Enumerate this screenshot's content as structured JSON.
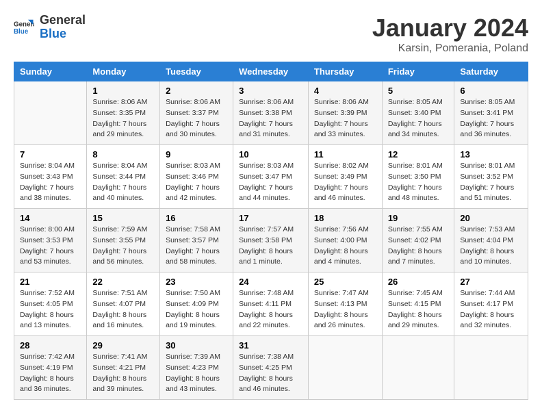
{
  "logo": {
    "line1": "General",
    "line2": "Blue"
  },
  "title": "January 2024",
  "subtitle": "Karsin, Pomerania, Poland",
  "days_of_week": [
    "Sunday",
    "Monday",
    "Tuesday",
    "Wednesday",
    "Thursday",
    "Friday",
    "Saturday"
  ],
  "weeks": [
    [
      {
        "day": "",
        "info": ""
      },
      {
        "day": "1",
        "info": "Sunrise: 8:06 AM\nSunset: 3:35 PM\nDaylight: 7 hours\nand 29 minutes."
      },
      {
        "day": "2",
        "info": "Sunrise: 8:06 AM\nSunset: 3:37 PM\nDaylight: 7 hours\nand 30 minutes."
      },
      {
        "day": "3",
        "info": "Sunrise: 8:06 AM\nSunset: 3:38 PM\nDaylight: 7 hours\nand 31 minutes."
      },
      {
        "day": "4",
        "info": "Sunrise: 8:06 AM\nSunset: 3:39 PM\nDaylight: 7 hours\nand 33 minutes."
      },
      {
        "day": "5",
        "info": "Sunrise: 8:05 AM\nSunset: 3:40 PM\nDaylight: 7 hours\nand 34 minutes."
      },
      {
        "day": "6",
        "info": "Sunrise: 8:05 AM\nSunset: 3:41 PM\nDaylight: 7 hours\nand 36 minutes."
      }
    ],
    [
      {
        "day": "7",
        "info": "Sunrise: 8:04 AM\nSunset: 3:43 PM\nDaylight: 7 hours\nand 38 minutes."
      },
      {
        "day": "8",
        "info": "Sunrise: 8:04 AM\nSunset: 3:44 PM\nDaylight: 7 hours\nand 40 minutes."
      },
      {
        "day": "9",
        "info": "Sunrise: 8:03 AM\nSunset: 3:46 PM\nDaylight: 7 hours\nand 42 minutes."
      },
      {
        "day": "10",
        "info": "Sunrise: 8:03 AM\nSunset: 3:47 PM\nDaylight: 7 hours\nand 44 minutes."
      },
      {
        "day": "11",
        "info": "Sunrise: 8:02 AM\nSunset: 3:49 PM\nDaylight: 7 hours\nand 46 minutes."
      },
      {
        "day": "12",
        "info": "Sunrise: 8:01 AM\nSunset: 3:50 PM\nDaylight: 7 hours\nand 48 minutes."
      },
      {
        "day": "13",
        "info": "Sunrise: 8:01 AM\nSunset: 3:52 PM\nDaylight: 7 hours\nand 51 minutes."
      }
    ],
    [
      {
        "day": "14",
        "info": "Sunrise: 8:00 AM\nSunset: 3:53 PM\nDaylight: 7 hours\nand 53 minutes."
      },
      {
        "day": "15",
        "info": "Sunrise: 7:59 AM\nSunset: 3:55 PM\nDaylight: 7 hours\nand 56 minutes."
      },
      {
        "day": "16",
        "info": "Sunrise: 7:58 AM\nSunset: 3:57 PM\nDaylight: 7 hours\nand 58 minutes."
      },
      {
        "day": "17",
        "info": "Sunrise: 7:57 AM\nSunset: 3:58 PM\nDaylight: 8 hours\nand 1 minute."
      },
      {
        "day": "18",
        "info": "Sunrise: 7:56 AM\nSunset: 4:00 PM\nDaylight: 8 hours\nand 4 minutes."
      },
      {
        "day": "19",
        "info": "Sunrise: 7:55 AM\nSunset: 4:02 PM\nDaylight: 8 hours\nand 7 minutes."
      },
      {
        "day": "20",
        "info": "Sunrise: 7:53 AM\nSunset: 4:04 PM\nDaylight: 8 hours\nand 10 minutes."
      }
    ],
    [
      {
        "day": "21",
        "info": "Sunrise: 7:52 AM\nSunset: 4:05 PM\nDaylight: 8 hours\nand 13 minutes."
      },
      {
        "day": "22",
        "info": "Sunrise: 7:51 AM\nSunset: 4:07 PM\nDaylight: 8 hours\nand 16 minutes."
      },
      {
        "day": "23",
        "info": "Sunrise: 7:50 AM\nSunset: 4:09 PM\nDaylight: 8 hours\nand 19 minutes."
      },
      {
        "day": "24",
        "info": "Sunrise: 7:48 AM\nSunset: 4:11 PM\nDaylight: 8 hours\nand 22 minutes."
      },
      {
        "day": "25",
        "info": "Sunrise: 7:47 AM\nSunset: 4:13 PM\nDaylight: 8 hours\nand 26 minutes."
      },
      {
        "day": "26",
        "info": "Sunrise: 7:45 AM\nSunset: 4:15 PM\nDaylight: 8 hours\nand 29 minutes."
      },
      {
        "day": "27",
        "info": "Sunrise: 7:44 AM\nSunset: 4:17 PM\nDaylight: 8 hours\nand 32 minutes."
      }
    ],
    [
      {
        "day": "28",
        "info": "Sunrise: 7:42 AM\nSunset: 4:19 PM\nDaylight: 8 hours\nand 36 minutes."
      },
      {
        "day": "29",
        "info": "Sunrise: 7:41 AM\nSunset: 4:21 PM\nDaylight: 8 hours\nand 39 minutes."
      },
      {
        "day": "30",
        "info": "Sunrise: 7:39 AM\nSunset: 4:23 PM\nDaylight: 8 hours\nand 43 minutes."
      },
      {
        "day": "31",
        "info": "Sunrise: 7:38 AM\nSunset: 4:25 PM\nDaylight: 8 hours\nand 46 minutes."
      },
      {
        "day": "",
        "info": ""
      },
      {
        "day": "",
        "info": ""
      },
      {
        "day": "",
        "info": ""
      }
    ]
  ]
}
